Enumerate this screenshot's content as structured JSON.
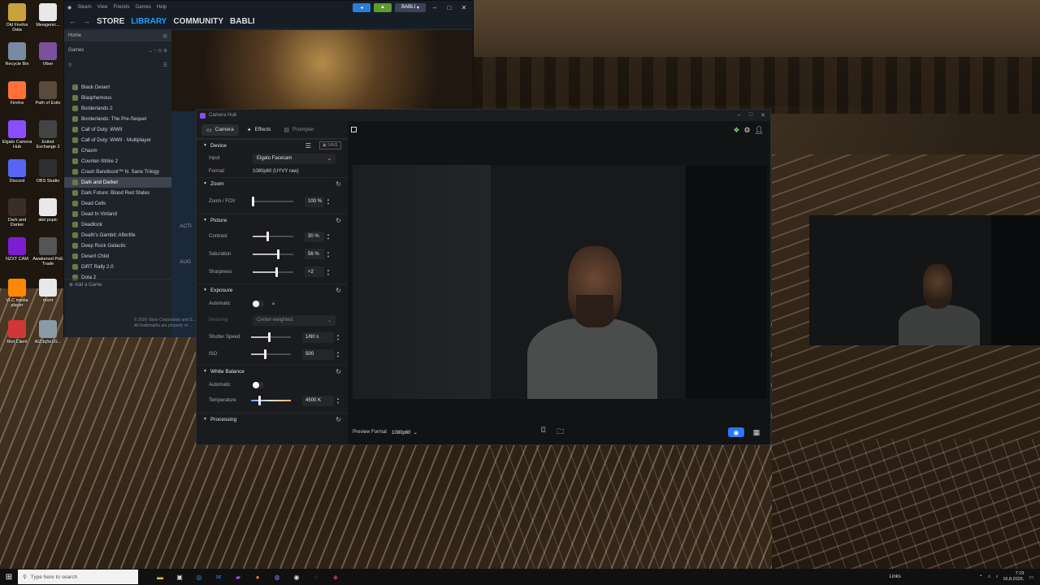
{
  "desktop": {
    "icons": [
      {
        "label": "Old Firefox Data",
        "color": "#c8a23a"
      },
      {
        "label": "Mewgenic...",
        "color": "#e8e8e8"
      },
      {
        "label": "Recycle Bin",
        "color": "#7a8aa0"
      },
      {
        "label": "Viber",
        "color": "#7b519d"
      },
      {
        "label": "Firefox",
        "color": "#ff7139"
      },
      {
        "label": "Path of Exile",
        "color": "#5a4a3a"
      },
      {
        "label": "Elgato Camera Hub",
        "color": "#8a4dff"
      },
      {
        "label": "Exiled Exchange 2",
        "color": "#444444"
      },
      {
        "label": "Discord",
        "color": "#5865f2"
      },
      {
        "label": "OBS Studio",
        "color": "#302e31"
      },
      {
        "label": "Dark and Darker",
        "color": "#3a2e26"
      },
      {
        "label": "alet popic",
        "color": "#e8e8e8"
      },
      {
        "label": "NZXT CAM",
        "color": "#7d1dd1"
      },
      {
        "label": "Awakened PoE Trade",
        "color": "#555555"
      },
      {
        "label": "VLC media player",
        "color": "#ff8800"
      },
      {
        "label": "mont",
        "color": "#e8e8e8"
      },
      {
        "label": "Riot Client",
        "color": "#d13639"
      },
      {
        "label": "AIZ3q5e1G...",
        "color": "#8a9aa8"
      }
    ]
  },
  "steam": {
    "menu": [
      "Steam",
      "View",
      "Friends",
      "Games",
      "Help"
    ],
    "user": "BABLI",
    "nav": [
      "STORE",
      "LIBRARY",
      "COMMUNITY",
      "BABLI"
    ],
    "active_nav": "LIBRARY",
    "home": "Home",
    "filter": "Games",
    "games": [
      "Black Desert",
      "Blasphemous",
      "Borderlands 2",
      "Borderlands: The Pre-Sequel",
      "Call of Duty: WWII",
      "Call of Duty: WWII - Multiplayer",
      "Chasm",
      "Counter-Strike 2",
      "Crash Bandicoot™ N. Sane Trilogy",
      "Dark and Darker",
      "Dark Future: Blood Red States",
      "Dead Cells",
      "Dead In Vinland",
      "Deadlock",
      "Death's Gambit: Afterlife",
      "Deep Rock Galactic",
      "Desert Child",
      "DiRT Rally 2.0",
      "Dota 2"
    ],
    "selected_game": "Dark and Darker",
    "add_game": "Add a Game",
    "copyright": "© 2026 Valve Corporation and S...",
    "copyright2": "All trademarks are property of ...",
    "main_labels": [
      "ACTI",
      "AUG"
    ]
  },
  "camerahub": {
    "title": "Camera Hub",
    "tabs": {
      "camera": "Camera",
      "effects": "Effects",
      "prompter": "Prompter"
    },
    "device": {
      "header": "Device",
      "save": "SAVE",
      "input_label": "Input",
      "input_value": "Elgato Facecam",
      "format_label": "Format",
      "format_value": "1080p60 (UYVY raw)"
    },
    "zoom": {
      "header": "Zoom",
      "label": "Zoom / FOV",
      "value": "100 %",
      "level": 0
    },
    "picture": {
      "header": "Picture",
      "contrast_label": "Contrast",
      "contrast_value": "30 %",
      "contrast_level": 0.35,
      "saturation_label": "Saturation",
      "saturation_value": "56 %",
      "saturation_level": 0.62,
      "sharpness_label": "Sharpness",
      "sharpness_value": "+2",
      "sharpness_level": 0.58
    },
    "exposure": {
      "header": "Exposure",
      "auto_label": "Automatic",
      "metering_label": "Metering",
      "metering_value": "Center-weighted",
      "shutter_label": "Shutter Speed",
      "shutter_value": "1/60 s",
      "shutter_level": 0.45,
      "iso_label": "ISO",
      "iso_value": "500",
      "iso_level": 0.35
    },
    "white_balance": {
      "header": "White Balance",
      "auto_label": "Automatic",
      "temp_label": "Temperature",
      "temp_value": "4500 K",
      "temp_level": 0.2
    },
    "processing": {
      "header": "Processing"
    },
    "preview": {
      "format_label": "Preview Format",
      "format_value": "1080p60"
    }
  },
  "taskbar": {
    "search_placeholder": "Type here to search",
    "tray_text": "Links",
    "time": "7:19",
    "date": "16.8.2026."
  }
}
